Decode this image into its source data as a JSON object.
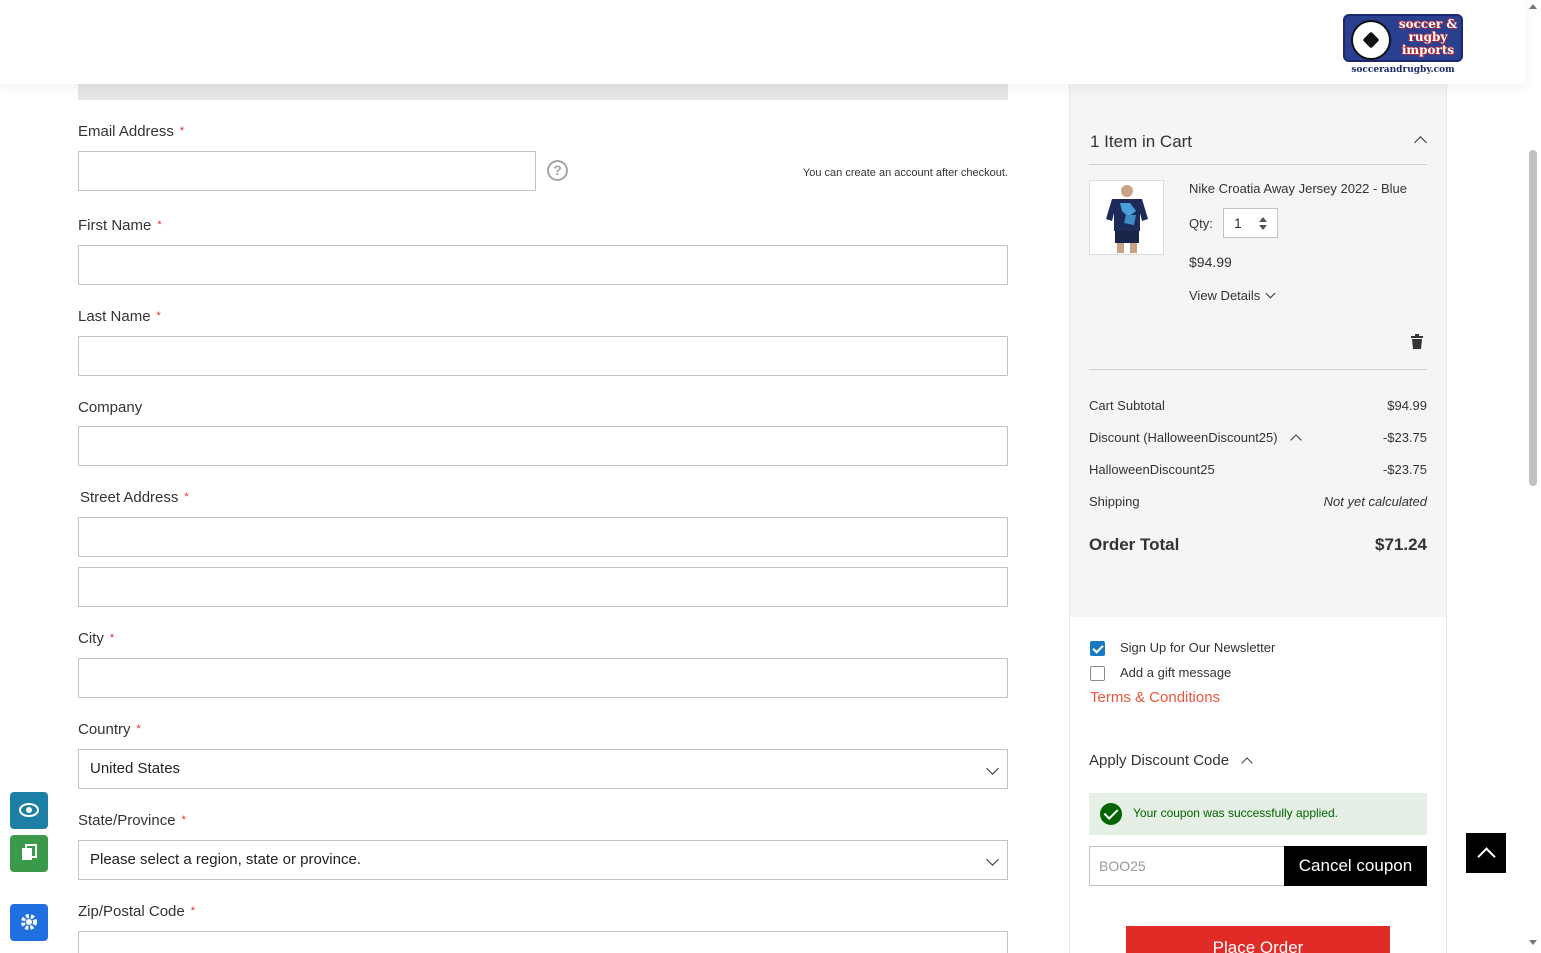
{
  "header": {
    "logo_text": "soccer & rugby imports",
    "logo_url": "soccerandrugby.com"
  },
  "form": {
    "email": {
      "label": "Email Address",
      "value": "",
      "note": "You can create an account after checkout."
    },
    "first_name": {
      "label": "First Name",
      "value": ""
    },
    "last_name": {
      "label": "Last Name",
      "value": ""
    },
    "company": {
      "label": "Company",
      "value": ""
    },
    "street": {
      "label": "Street Address",
      "line1": "",
      "line2": ""
    },
    "city": {
      "label": "City",
      "value": ""
    },
    "country": {
      "label": "Country",
      "value": "United States"
    },
    "state": {
      "label": "State/Province",
      "value": "Please select a region, state or province."
    },
    "zip": {
      "label": "Zip/Postal Code",
      "value": ""
    },
    "required_mark": "*"
  },
  "summary": {
    "cart_title": "1 Item in Cart",
    "item": {
      "name": "Nike Croatia Away Jersey 2022 - Blue",
      "qty_label": "Qty:",
      "qty": "1",
      "price": "$94.99",
      "view_details": "View Details"
    },
    "totals": {
      "subtotal_label": "Cart Subtotal",
      "subtotal": "$94.99",
      "discount_label": "Discount (HalloweenDiscount25)",
      "discount": "-$23.75",
      "code_label": "HalloweenDiscount25",
      "code_amount": "-$23.75",
      "shipping_label": "Shipping",
      "shipping": "Not yet calculated",
      "order_total_label": "Order Total",
      "order_total": "$71.24"
    },
    "newsletter_label": "Sign Up for Our Newsletter",
    "newsletter_checked": true,
    "gift_label": "Add a gift message",
    "gift_checked": false,
    "terms": "Terms & Conditions",
    "discount_title": "Apply Discount Code",
    "success_message": "Your coupon was successfully applied.",
    "coupon_value": "BOO25",
    "cancel_coupon": "Cancel coupon",
    "place_order": "Place Order"
  },
  "colors": {
    "accent_red": "#e02b27",
    "link_orange": "#e8553e",
    "success_green": "#006400",
    "checkbox_blue": "#1979c3"
  }
}
